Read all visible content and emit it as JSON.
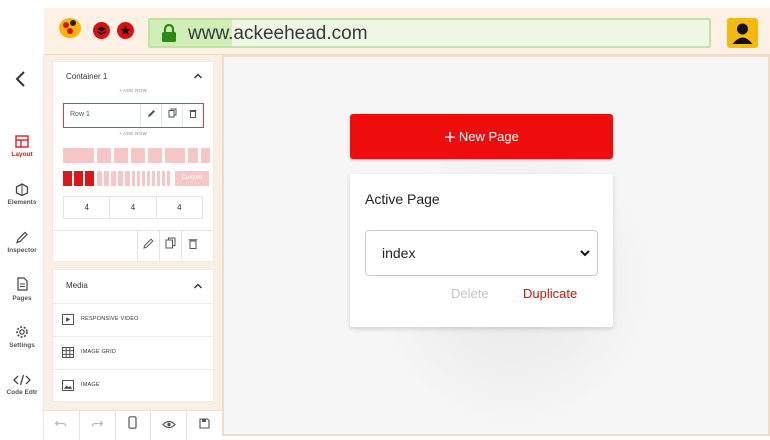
{
  "browser": {
    "url": "www.ackeehead.com",
    "accent": "#cfefb6"
  },
  "rail": {
    "items": [
      {
        "label": "Layout",
        "icon": "layout-icon",
        "active": true
      },
      {
        "label": "Elements",
        "icon": "elements-icon"
      },
      {
        "label": "Inspector",
        "icon": "pencil-icon"
      },
      {
        "label": "Pages",
        "icon": "pages-icon"
      },
      {
        "label": "Settings",
        "icon": "gear-icon"
      },
      {
        "label": "Code Edtr",
        "icon": "code-icon"
      }
    ]
  },
  "container_panel": {
    "title": "Container 1",
    "add_row_top": "+ ADD ROW",
    "row_label": "Row 1",
    "add_row_bottom": "+ ADD ROW",
    "custom_label": "Custom",
    "columns": [
      "4",
      "4",
      "4"
    ]
  },
  "media_panel": {
    "title": "Media",
    "items": [
      {
        "label": "RESPONSIVE VIDEO",
        "icon": "video-icon"
      },
      {
        "label": "IMAGE GRID",
        "icon": "grid-icon"
      },
      {
        "label": "IMAGE",
        "icon": "image-icon"
      }
    ]
  },
  "canvas": {
    "new_page_label": "New Page",
    "active_page_title": "Active Page",
    "active_page_value": "index",
    "delete_label": "Delete",
    "duplicate_label": "Duplicate"
  },
  "colors": {
    "brand_red": "#ee0c0c",
    "panel_bg": "#fbeee2"
  }
}
